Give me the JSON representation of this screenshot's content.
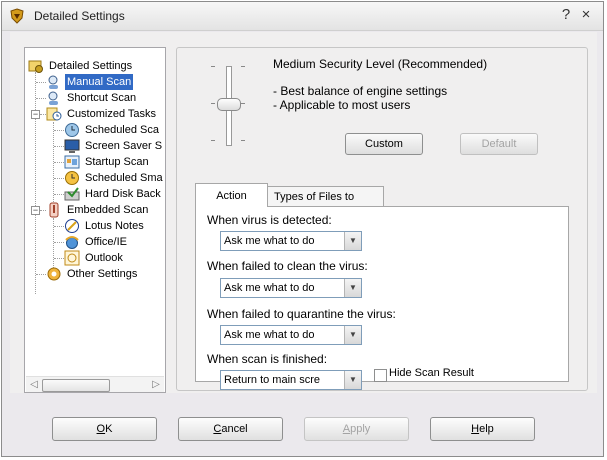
{
  "window": {
    "title": "Detailed Settings"
  },
  "titlebar": {
    "help_glyph": "?",
    "close_glyph": "×"
  },
  "tree": {
    "root": "Detailed Settings",
    "manual": "Manual Scan",
    "shortcut": "Shortcut Scan",
    "customized": "Customized Tasks",
    "scheduled": "Scheduled Sca",
    "screensaver": "Screen Saver S",
    "startup": "Startup Scan",
    "smart": "Scheduled Sma",
    "harddisk": "Hard Disk Back",
    "embedded": "Embedded Scan",
    "lotus": "Lotus Notes",
    "office": "Office/IE",
    "outlook": "Outlook",
    "other": "Other Settings"
  },
  "security": {
    "title": "Medium Security Level (Recommended)",
    "line1": "- Best balance of engine settings",
    "line2": "- Applicable to most users",
    "custom_button": "Custom",
    "default_button": "Default"
  },
  "tabs": {
    "action": "Action",
    "types": "Types of Files to Scan"
  },
  "action": {
    "q1": "When virus is detected:",
    "q1_value": "Ask me what to do",
    "q2": "When failed to clean the virus:",
    "q2_value": "Ask me what to do",
    "q3": "When failed to quarantine the virus:",
    "q3_value": "Ask me what to do",
    "q4": "When scan is finished:",
    "q4_value": "Return to main scre",
    "hide_result": "Hide Scan Result"
  },
  "footer": {
    "ok_u": "O",
    "ok_rest": "K",
    "cancel_u": "C",
    "cancel_rest": "ancel",
    "apply_u": "A",
    "apply_rest": "pply",
    "help_u": "H",
    "help_rest": "elp"
  },
  "colors": {
    "selection": "#316ac5",
    "window_bg": "#ebe9ed"
  }
}
